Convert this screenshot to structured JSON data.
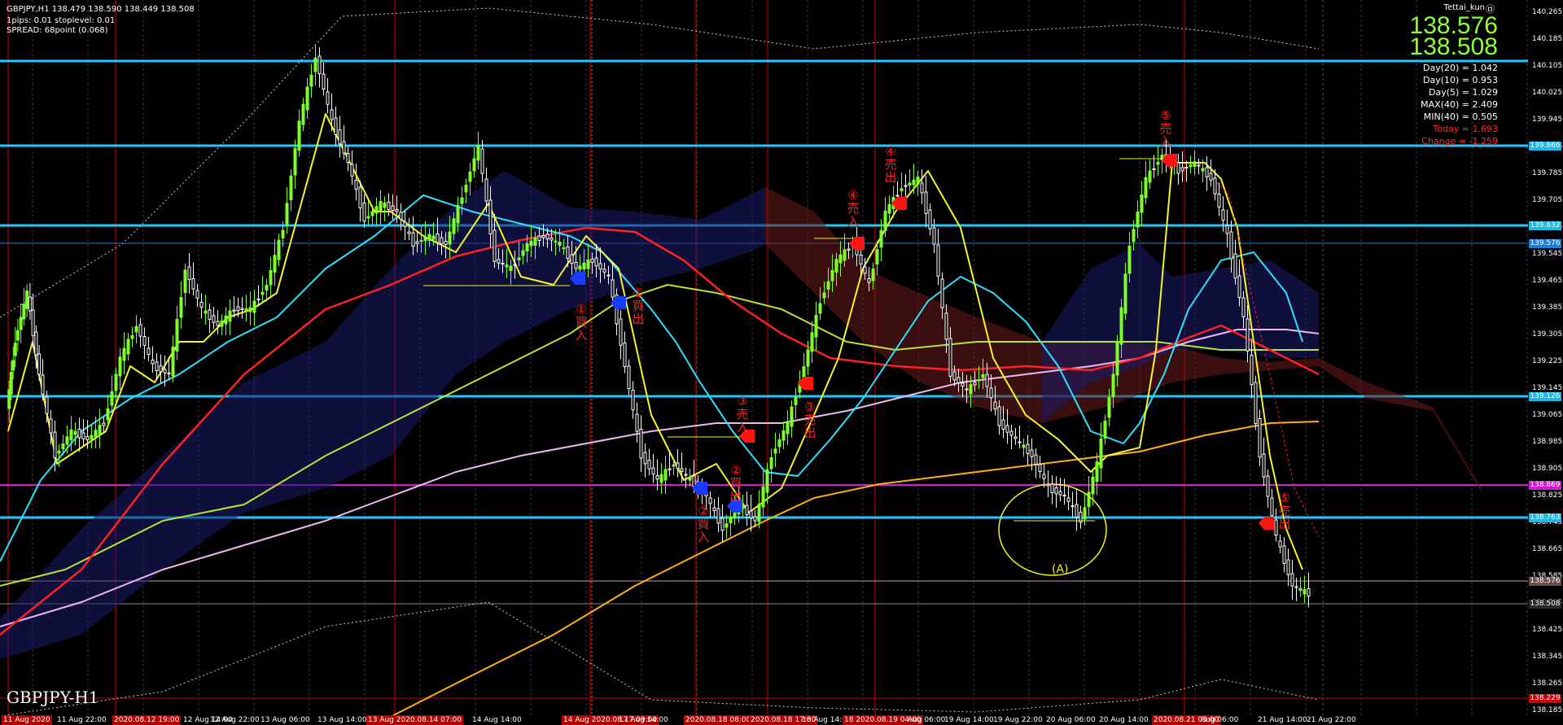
{
  "header": {
    "symbol_line": "GBPJPY,H1  138.479 138.590 138.449 138.508",
    "spec_line": "1pips: 0.01  stoplevel: 0.01",
    "spread_line": "SPREAD: 68point (0.068)"
  },
  "author": {
    "name": "Tettai_kun",
    "mark": "㉤"
  },
  "prices": {
    "ask": "138.576",
    "bid": "138.508"
  },
  "stats": [
    {
      "text": "Day(20) = 1.042",
      "color": "#ffffff"
    },
    {
      "text": "Day(10) = 0.953",
      "color": "#ffffff"
    },
    {
      "text": "Day(5) = 1.029",
      "color": "#ffffff"
    },
    {
      "text": "MAX(40) = 2.409",
      "color": "#ffffff"
    },
    {
      "text": "MIN(40) = 0.505",
      "color": "#ffffff"
    },
    {
      "text": "Today = 1.693",
      "color": "#ff2a2a"
    },
    {
      "text": "Change = -1.259",
      "color": "#ff2a2a"
    }
  ],
  "watermark": "GBPJPY-H1",
  "price_axis": {
    "ticks": [
      "140.265",
      "140.185",
      "140.105",
      "140.025",
      "139.945",
      "139.866",
      "139.785",
      "139.705",
      "139.625",
      "139.545",
      "139.465",
      "139.385",
      "139.305",
      "139.225",
      "139.145",
      "139.065",
      "138.985",
      "138.905",
      "138.825",
      "138.745",
      "138.665",
      "138.585",
      "138.505",
      "138.425",
      "138.345",
      "138.265",
      "138.185"
    ],
    "tags": [
      {
        "label": "139.866",
        "bg": "#1fb8e6"
      },
      {
        "label": "139.632",
        "bg": "#1fb8e6"
      },
      {
        "label": "139.576",
        "bg": "#1e7fd8"
      },
      {
        "label": "139.126",
        "bg": "#1fb8e6"
      },
      {
        "label": "138.869",
        "bg": "#d21ad2"
      },
      {
        "label": "138.763",
        "bg": "#1fb8e6"
      },
      {
        "label": "138.576",
        "bg": "#6b5050"
      },
      {
        "label": "138.508",
        "bg": "#2b2b2b"
      },
      {
        "label": "138.229",
        "bg": "#d00000"
      }
    ]
  },
  "time_axis": [
    {
      "label": "11 Aug 2020",
      "hl": true
    },
    {
      "label": "11 Aug 22:00",
      "hl": false
    },
    {
      "label": "2020.08.12 19:00",
      "hl": true
    },
    {
      "label": "12 Aug 14:00",
      "hl": false
    },
    {
      "label": "12 Aug 22:00",
      "hl": false
    },
    {
      "label": "13 Aug 06:00",
      "hl": false
    },
    {
      "label": "13 Aug 14:00",
      "hl": false
    },
    {
      "label": "13 Aug 2020.08.14 07:00",
      "hl": true
    },
    {
      "label": "14 Aug 14:00",
      "hl": false
    },
    {
      "label": "14 Aug 2020.08.17 09:00",
      "hl": true
    },
    {
      "label": "17 Aug 14:00",
      "hl": false
    },
    {
      "label": "2020.08.18 08:00",
      "hl": true
    },
    {
      "label": "2020.08.18 17:00",
      "hl": true
    },
    {
      "label": "18 Aug 14:00",
      "hl": false
    },
    {
      "label": "18 2020.08.19 04:00",
      "hl": true
    },
    {
      "label": "Aug 06:00",
      "hl": false
    },
    {
      "label": "19 Aug 14:00",
      "hl": false
    },
    {
      "label": "19 Aug 22:00",
      "hl": false
    },
    {
      "label": "20 Aug 06:00",
      "hl": false
    },
    {
      "label": "20 Aug 14:00",
      "hl": false
    },
    {
      "label": "2020.08.21 03:00",
      "hl": true
    },
    {
      "label": "Aug 06:00",
      "hl": false
    },
    {
      "label": "21 Aug 14:00",
      "hl": false
    },
    {
      "label": "21 Aug 22:00",
      "hl": false
    }
  ],
  "markers": [
    {
      "label": "①買入",
      "side": "buy"
    },
    {
      "label": "①買出",
      "side": "buy"
    },
    {
      "label": "②買入",
      "side": "buy"
    },
    {
      "label": "②買出",
      "side": "buy"
    },
    {
      "label": "③売入",
      "side": "sell"
    },
    {
      "label": "③売出",
      "side": "sell"
    },
    {
      "label": "④売入",
      "side": "sell"
    },
    {
      "label": "④売出",
      "side": "sell"
    },
    {
      "label": "⑤売入",
      "side": "sell"
    },
    {
      "label": "⑤売出",
      "side": "sell"
    }
  ],
  "annotation": "(A)",
  "colors": {
    "bull": "#7cff2a",
    "bear": "#ffffff",
    "hline": "#1fc8ff",
    "vline": "#d40000",
    "buy_marker": "#1a3cff",
    "sell_marker": "#ff1414",
    "ma_yellow": "#f5f52a",
    "ma_cyan": "#2ee0ff",
    "ma_red": "#ff2020",
    "ma_lime": "#b8e23a",
    "ma_pink": "#f0b8f0",
    "ma_orange": "#ffae1a"
  }
}
